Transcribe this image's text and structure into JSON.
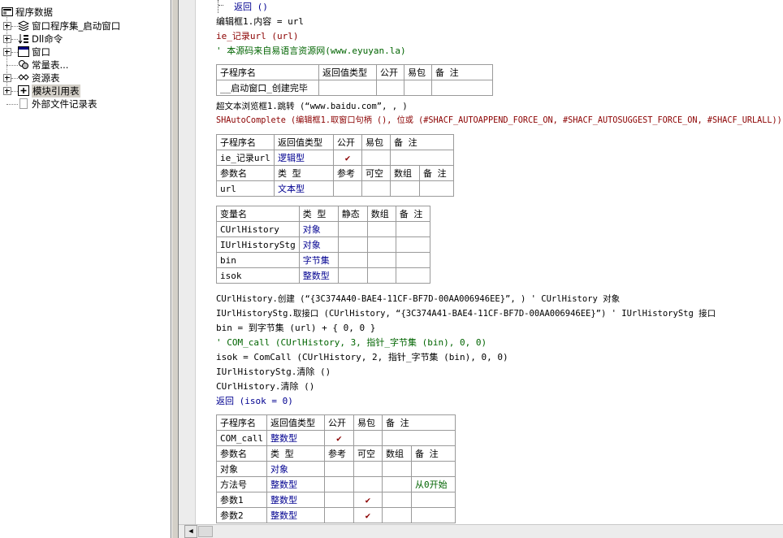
{
  "tree": {
    "root": "程序数据",
    "items": [
      {
        "label": "窗口程序集_启动窗口",
        "icon": "assembly-icon",
        "expandable": true
      },
      {
        "label": "Dll命令",
        "icon": "dll-command-icon",
        "expandable": true
      },
      {
        "label": "窗口",
        "icon": "window-icon",
        "expandable": true
      },
      {
        "label": "常量表...",
        "icon": "constants-icon",
        "expandable": false
      },
      {
        "label": "资源表",
        "icon": "resources-icon",
        "expandable": true
      },
      {
        "label": "模块引用表",
        "icon": "module-ref-icon",
        "expandable": true
      },
      {
        "label": "外部文件记录表",
        "icon": "external-file-icon",
        "expandable": false
      }
    ]
  },
  "code": {
    "l_return_top": "返回 ()",
    "l_edit_content": "编辑框1.内容 = url",
    "l_ie_call": "ie_记录url (url)",
    "l_comment_source": "' 本源码来自易语言资源网(www.eyuyan.la)",
    "l_browser_jump": "超文本浏览框1.跳转 (“www.baidu.com”, , )",
    "l_shauto": "SHAutoComplete (编辑框1.取窗口句柄 (), 位或 (#SHACF_AUTOAPPEND_FORCE_ON, #SHACF_AUTOSUGGEST_FORCE_ON, #SHACF_URLALL))",
    "l_create": "CUrlHistory.创建 (“{3C374A40-BAE4-11CF-BF7D-00AA006946EE}”, ) ' CUrlHistory 对象",
    "l_getif": "IUrlHistoryStg.取接口 (CUrlHistory, “{3C374A41-BAE4-11CF-BF7D-00AA006946EE}”) ' IUrlHistoryStg 接口",
    "l_bin": "bin = 到字节集 (url) + { 0, 0 }",
    "l_comcall_comment": "' COM_call (CUrlHistory, 3, 指针_字节集 (bin), 0, 0)",
    "l_isok": "isok = ComCall (CUrlHistory, 2, 指针_字节集 (bin), 0, 0)",
    "l_clear1": "IUrlHistoryStg.清除 ()",
    "l_clear2": "CUrlHistory.清除 ()",
    "l_return_isok": "返回 (isok = 0)"
  },
  "table1": {
    "headers": [
      "子程序名",
      "返回值类型",
      "公开",
      "易包",
      "备 注"
    ],
    "row": [
      "__启动窗口_创建完毕",
      "",
      "",
      "",
      ""
    ]
  },
  "table2": {
    "headers": [
      "子程序名",
      "返回值类型",
      "公开",
      "易包",
      "备 注"
    ],
    "row": [
      "ie_记录url",
      "逻辑型",
      "✔",
      "",
      ""
    ],
    "param_headers": [
      "参数名",
      "类 型",
      "参考",
      "可空",
      "数组",
      "备 注"
    ],
    "params": [
      [
        "url",
        "文本型",
        "",
        "",
        "",
        ""
      ]
    ]
  },
  "table3": {
    "headers": [
      "变量名",
      "类 型",
      "静态",
      "数组",
      "备 注"
    ],
    "rows": [
      [
        "CUrlHistory",
        "对象",
        "",
        "",
        ""
      ],
      [
        "IUrlHistoryStg",
        "对象",
        "",
        "",
        ""
      ],
      [
        "bin",
        "字节集",
        "",
        "",
        ""
      ],
      [
        "isok",
        "整数型",
        "",
        "",
        ""
      ]
    ]
  },
  "table4": {
    "headers": [
      "子程序名",
      "返回值类型",
      "公开",
      "易包",
      "备 注"
    ],
    "row": [
      "COM_call",
      "整数型",
      "✔",
      "",
      ""
    ],
    "param_headers": [
      "参数名",
      "类 型",
      "参考",
      "可空",
      "数组",
      "备 注"
    ],
    "params": [
      [
        "对象",
        "对象",
        "",
        "",
        "",
        ""
      ],
      [
        "方法号",
        "整数型",
        "",
        "",
        "",
        "从0开始"
      ],
      [
        "参数1",
        "整数型",
        "",
        "✔",
        "",
        ""
      ],
      [
        "参数2",
        "整数型",
        "",
        "✔",
        "",
        ""
      ]
    ]
  },
  "colors": {
    "keyword": "#8b0000",
    "comment": "#006400",
    "type": "#000090"
  }
}
